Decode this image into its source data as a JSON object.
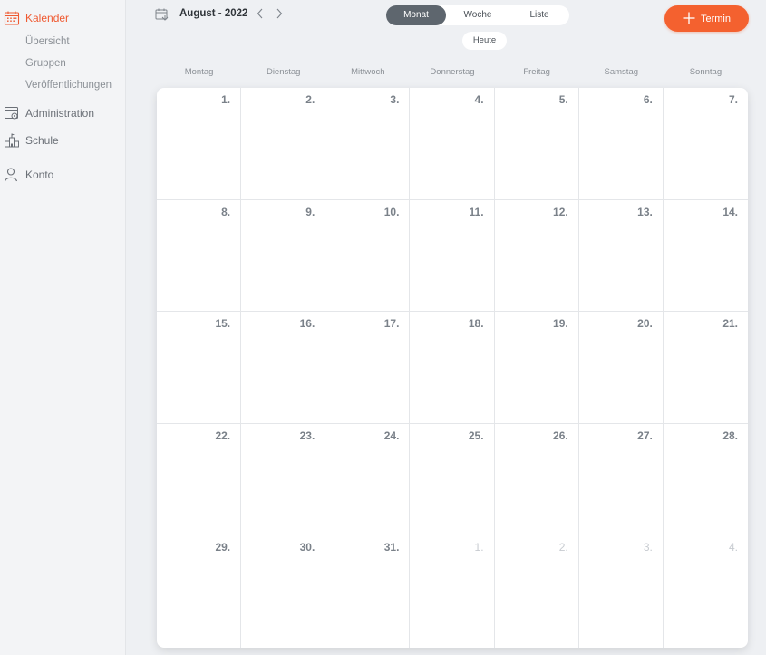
{
  "sidebar": {
    "items": [
      {
        "label": "Kalender",
        "icon": "calendar-icon",
        "active": true
      },
      {
        "label": "Administration",
        "icon": "settings-window-icon"
      },
      {
        "label": "Schule",
        "icon": "school-building-icon"
      },
      {
        "label": "Konto",
        "icon": "user-icon"
      }
    ],
    "sub_items": [
      {
        "label": "Übersicht"
      },
      {
        "label": "Gruppen"
      },
      {
        "label": "Veröffentlichungen"
      }
    ]
  },
  "toolbar": {
    "month": "August - 2022",
    "prev_icon": "chevron-left-icon",
    "next_icon": "chevron-right-icon",
    "views": [
      {
        "label": "Monat",
        "active": true
      },
      {
        "label": "Woche"
      },
      {
        "label": "Liste"
      }
    ],
    "today_label": "Heute",
    "add_label": "Termin",
    "accent_color": "#f4612f"
  },
  "calendar": {
    "weekdays": [
      "Montag",
      "Dienstag",
      "Mittwoch",
      "Donnerstag",
      "Freitag",
      "Samstag",
      "Sonntag"
    ],
    "weeks": [
      [
        {
          "d": "1."
        },
        {
          "d": "2."
        },
        {
          "d": "3."
        },
        {
          "d": "4."
        },
        {
          "d": "5."
        },
        {
          "d": "6."
        },
        {
          "d": "7."
        }
      ],
      [
        {
          "d": "8."
        },
        {
          "d": "9."
        },
        {
          "d": "10."
        },
        {
          "d": "11."
        },
        {
          "d": "12."
        },
        {
          "d": "13."
        },
        {
          "d": "14."
        }
      ],
      [
        {
          "d": "15."
        },
        {
          "d": "16."
        },
        {
          "d": "17."
        },
        {
          "d": "18."
        },
        {
          "d": "19."
        },
        {
          "d": "20."
        },
        {
          "d": "21."
        }
      ],
      [
        {
          "d": "22."
        },
        {
          "d": "23."
        },
        {
          "d": "24."
        },
        {
          "d": "25."
        },
        {
          "d": "26."
        },
        {
          "d": "27."
        },
        {
          "d": "28."
        }
      ],
      [
        {
          "d": "29."
        },
        {
          "d": "30."
        },
        {
          "d": "31."
        },
        {
          "d": "1.",
          "other": true
        },
        {
          "d": "2.",
          "other": true
        },
        {
          "d": "3.",
          "other": true
        },
        {
          "d": "4.",
          "other": true
        }
      ]
    ]
  }
}
